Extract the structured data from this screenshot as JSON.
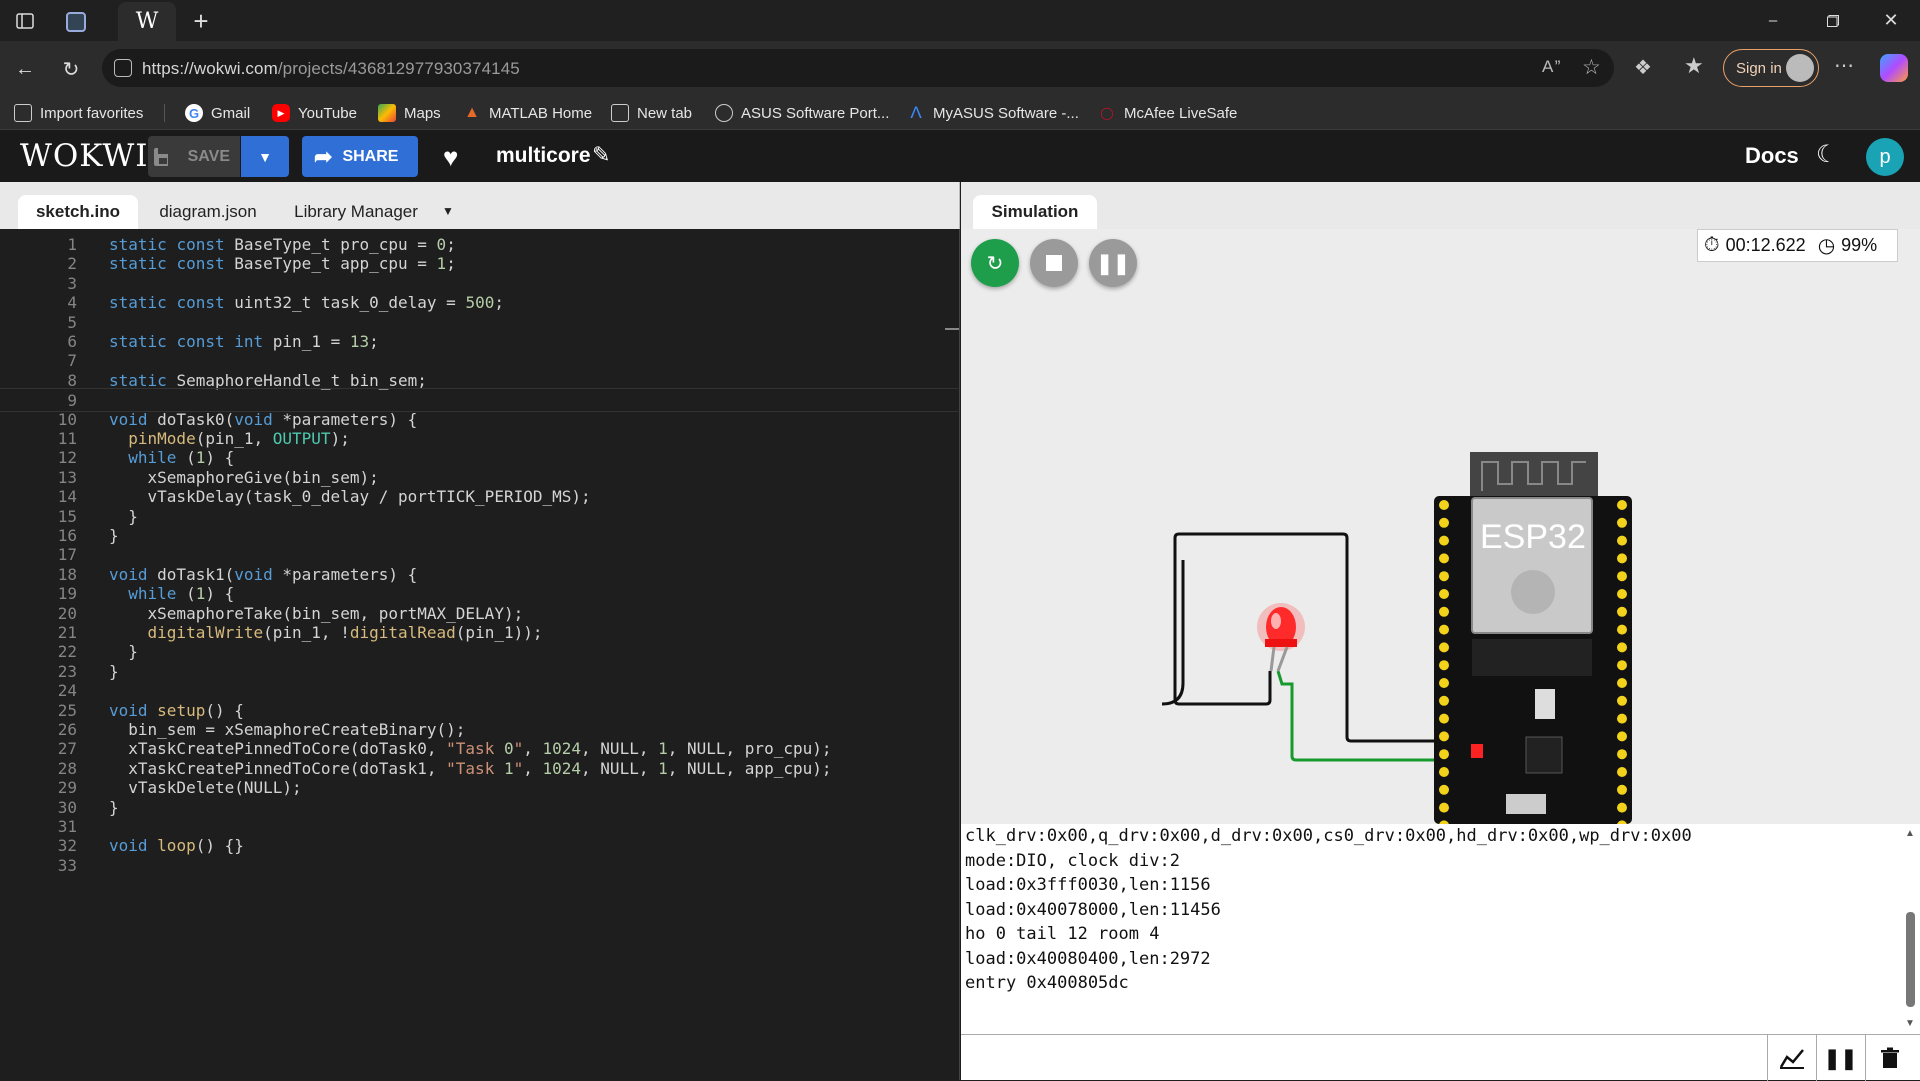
{
  "browser": {
    "url_host": "https://wokwi.com",
    "url_path": "/projects/436812977930374145",
    "signin_label": "Sign in",
    "tab_active_icon": "wokwi-w-icon",
    "bookmarks": [
      {
        "label": "Import favorites",
        "icon": "import-icon"
      },
      {
        "label": "Gmail",
        "icon": "google-icon"
      },
      {
        "label": "YouTube",
        "icon": "youtube-icon"
      },
      {
        "label": "Maps",
        "icon": "maps-icon"
      },
      {
        "label": "MATLAB Home",
        "icon": "matlab-icon"
      },
      {
        "label": "New tab",
        "icon": "newtab-icon"
      },
      {
        "label": "ASUS Software Port...",
        "icon": "globe-icon"
      },
      {
        "label": "MyASUS Software -...",
        "icon": "asus-icon"
      },
      {
        "label": "McAfee LiveSafe",
        "icon": "mcafee-icon"
      }
    ]
  },
  "wokwi": {
    "logo": "WOKWI",
    "save_label": "SAVE",
    "share_label": "SHARE",
    "project_name": "multicore",
    "docs_label": "Docs",
    "avatar_letter": "p",
    "accent": "#2f6fd6"
  },
  "editor": {
    "tabs": [
      "sketch.ino",
      "diagram.json",
      "Library Manager"
    ],
    "active_tab": "sketch.ino",
    "current_line": 9,
    "lines": [
      "static const BaseType_t pro_cpu = 0;",
      "static const BaseType_t app_cpu = 1;",
      "",
      "static const uint32_t task_0_delay = 500;",
      "",
      "static const int pin_1 = 13;",
      "",
      "static SemaphoreHandle_t bin_sem;",
      "",
      "void doTask0(void *parameters) {",
      "  pinMode(pin_1, OUTPUT);",
      "  while (1) {",
      "    xSemaphoreGive(bin_sem);",
      "    vTaskDelay(task_0_delay / portTICK_PERIOD_MS);",
      "  }",
      "}",
      "",
      "void doTask1(void *parameters) {",
      "  while (1) {",
      "    xSemaphoreTake(bin_sem, portMAX_DELAY);",
      "    digitalWrite(pin_1, !digitalRead(pin_1));",
      "  }",
      "}",
      "",
      "void setup() {",
      "  bin_sem = xSemaphoreCreateBinary();",
      "  xTaskCreatePinnedToCore(doTask0, \"Task 0\", 1024, NULL, 1, NULL, pro_cpu);",
      "  xTaskCreatePinnedToCore(doTask1, \"Task 1\", 1024, NULL, 1, NULL, app_cpu);",
      "  vTaskDelete(NULL);",
      "}",
      "",
      "void loop() {}",
      ""
    ]
  },
  "simulation": {
    "tab_label": "Simulation",
    "timer": "00:12.622",
    "speed": "99%",
    "board_label": "ESP32",
    "led_color": "#ff2a2a",
    "serial_lines": [
      "clk_drv:0x00,q_drv:0x00,d_drv:0x00,cs0_drv:0x00,hd_drv:0x00,wp_drv:0x00",
      "mode:DIO, clock div:2",
      "load:0x3fff0030,len:1156",
      "load:0x40078000,len:11456",
      "ho 0 tail 12 room 4",
      "load:0x40080400,len:2972",
      "entry 0x400805dc"
    ]
  }
}
